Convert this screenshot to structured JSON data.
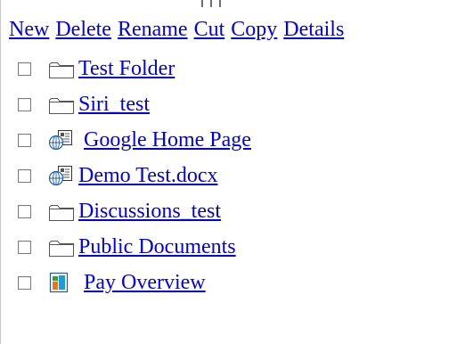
{
  "toolbar": {
    "new_label": "New",
    "delete_label": "Delete",
    "rename_label": "Rename",
    "cut_label": "Cut",
    "copy_label": "Copy",
    "details_label": "Details"
  },
  "items": [
    {
      "label": "Test  Folder",
      "icon": "folder-icon"
    },
    {
      "label": "Siri_test",
      "icon": "folder-icon"
    },
    {
      "label": "Google Home Page",
      "icon": "web-link-icon"
    },
    {
      "label": "Demo Test.docx",
      "icon": "web-link-icon"
    },
    {
      "label": "Discussions_test",
      "icon": "folder-icon"
    },
    {
      "label": "Public Documents",
      "icon": "folder-icon"
    },
    {
      "label": "Pay Overview",
      "icon": "report-chart-icon"
    }
  ]
}
